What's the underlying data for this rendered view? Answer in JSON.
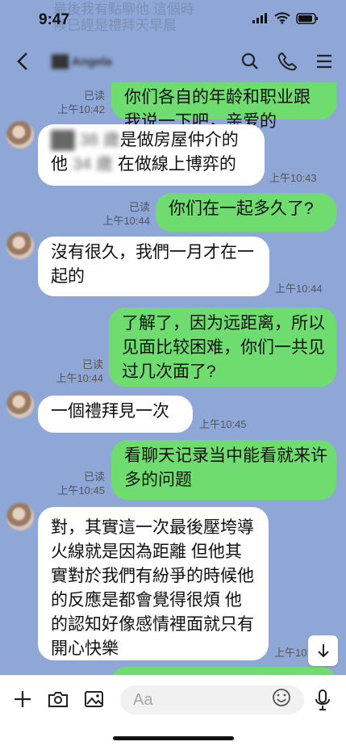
{
  "status_bar": {
    "time": "9:47"
  },
  "header": {
    "contact_name": "██ Angela"
  },
  "ghost_text": {
    "line1": "最後我有點聊他 這個時",
    "line2": "候已經是禮拜天早晨"
  },
  "messages": [
    {
      "side": "out",
      "text": "你们各自的年龄和职业跟我说一下吧，亲爱的",
      "read": "已读",
      "time": "上午10:42"
    },
    {
      "side": "in",
      "text": "██ 38 歲是做房屋仲介的 他 34 歲 在做線上博弈的",
      "time": "上午10:43"
    },
    {
      "side": "out",
      "text": "你们在一起多久了?",
      "read": "已读",
      "time": "上午10:44"
    },
    {
      "side": "in",
      "text": "沒有很久，我們一月才在一起的",
      "time": "上午10:44"
    },
    {
      "side": "out",
      "text": "了解了，因为远距离，所以见面比较困难，你们一共见过几次面了?",
      "read": "已读",
      "time": "上午10:44"
    },
    {
      "side": "in",
      "text": "一個禮拜見一次",
      "time": "上午10:45"
    },
    {
      "side": "out",
      "text": "看聊天记录当中能看就来许多的问题",
      "read": "已读",
      "time": "上午10:45"
    },
    {
      "side": "in",
      "text": "對，其實這一次最後壓垮導火線就是因為距離 但他其實對於我們有紛爭的時候他的反應是都會覺得很煩 他的認知好像感情裡面就只有開心快樂",
      "time": "上午10:46"
    }
  ],
  "composer": {
    "placeholder": "Aa"
  },
  "colors": {
    "background": "#8fa7d6",
    "incoming": "#ffffff",
    "outgoing": "#6fdc6f"
  },
  "icons": [
    "back-arrow-icon",
    "search-icon",
    "phone-icon",
    "menu-icon",
    "plus-icon",
    "camera-icon",
    "image-icon",
    "emoji-icon",
    "microphone-icon",
    "arrow-down-icon"
  ]
}
